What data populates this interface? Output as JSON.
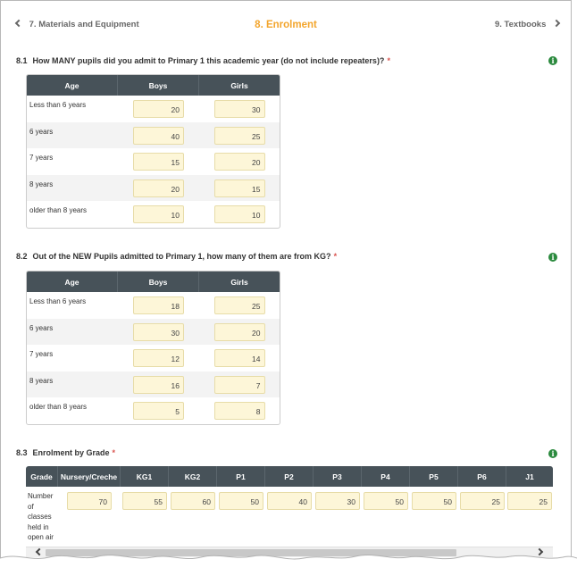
{
  "nav": {
    "prev": "7. Materials and Equipment",
    "title": "8. Enrolment",
    "next": "9. Textbooks"
  },
  "q1": {
    "number": "8.1",
    "text": "How MANY pupils did you admit to Primary 1 this academic year (do not include repeaters)?",
    "required": "*",
    "headers": [
      "Age",
      "Boys",
      "Girls"
    ],
    "rows": [
      {
        "label": "Less than 6 years",
        "boys": "20",
        "girls": "30"
      },
      {
        "label": "6 years",
        "boys": "40",
        "girls": "25"
      },
      {
        "label": "7 years",
        "boys": "15",
        "girls": "20"
      },
      {
        "label": "8 years",
        "boys": "20",
        "girls": "15"
      },
      {
        "label": "older than 8 years",
        "boys": "10",
        "girls": "10"
      }
    ]
  },
  "q2": {
    "number": "8.2",
    "text": "Out of the NEW Pupils admitted to Primary 1, how many of them are from KG?",
    "required": "*",
    "headers": [
      "Age",
      "Boys",
      "Girls"
    ],
    "rows": [
      {
        "label": "Less than 6 years",
        "boys": "18",
        "girls": "25"
      },
      {
        "label": "6 years",
        "boys": "30",
        "girls": "20"
      },
      {
        "label": "7 years",
        "boys": "12",
        "girls": "14"
      },
      {
        "label": "8 years",
        "boys": "16",
        "girls": "7"
      },
      {
        "label": "older than 8 years",
        "boys": "5",
        "girls": "8"
      }
    ]
  },
  "q3": {
    "number": "8.3",
    "text": "Enrolment by Grade",
    "required": "*",
    "headers": [
      "Grade",
      "Nursery/Creche",
      "KG1",
      "KG2",
      "P1",
      "P2",
      "P3",
      "P4",
      "P5",
      "P6",
      "J1"
    ],
    "row_label": "Number of classes held in open air",
    "values": [
      "70",
      "55",
      "60",
      "50",
      "40",
      "30",
      "50",
      "50",
      "25",
      "25"
    ]
  },
  "icons": {
    "info": "info-icon",
    "prev": "chevron-left-icon",
    "next": "chevron-right-icon"
  },
  "colors": {
    "accent": "#f3a52c",
    "header": "#475259",
    "input_bg": "#fdf6d8",
    "info": "#2b8a3e",
    "required": "#d9534f"
  }
}
